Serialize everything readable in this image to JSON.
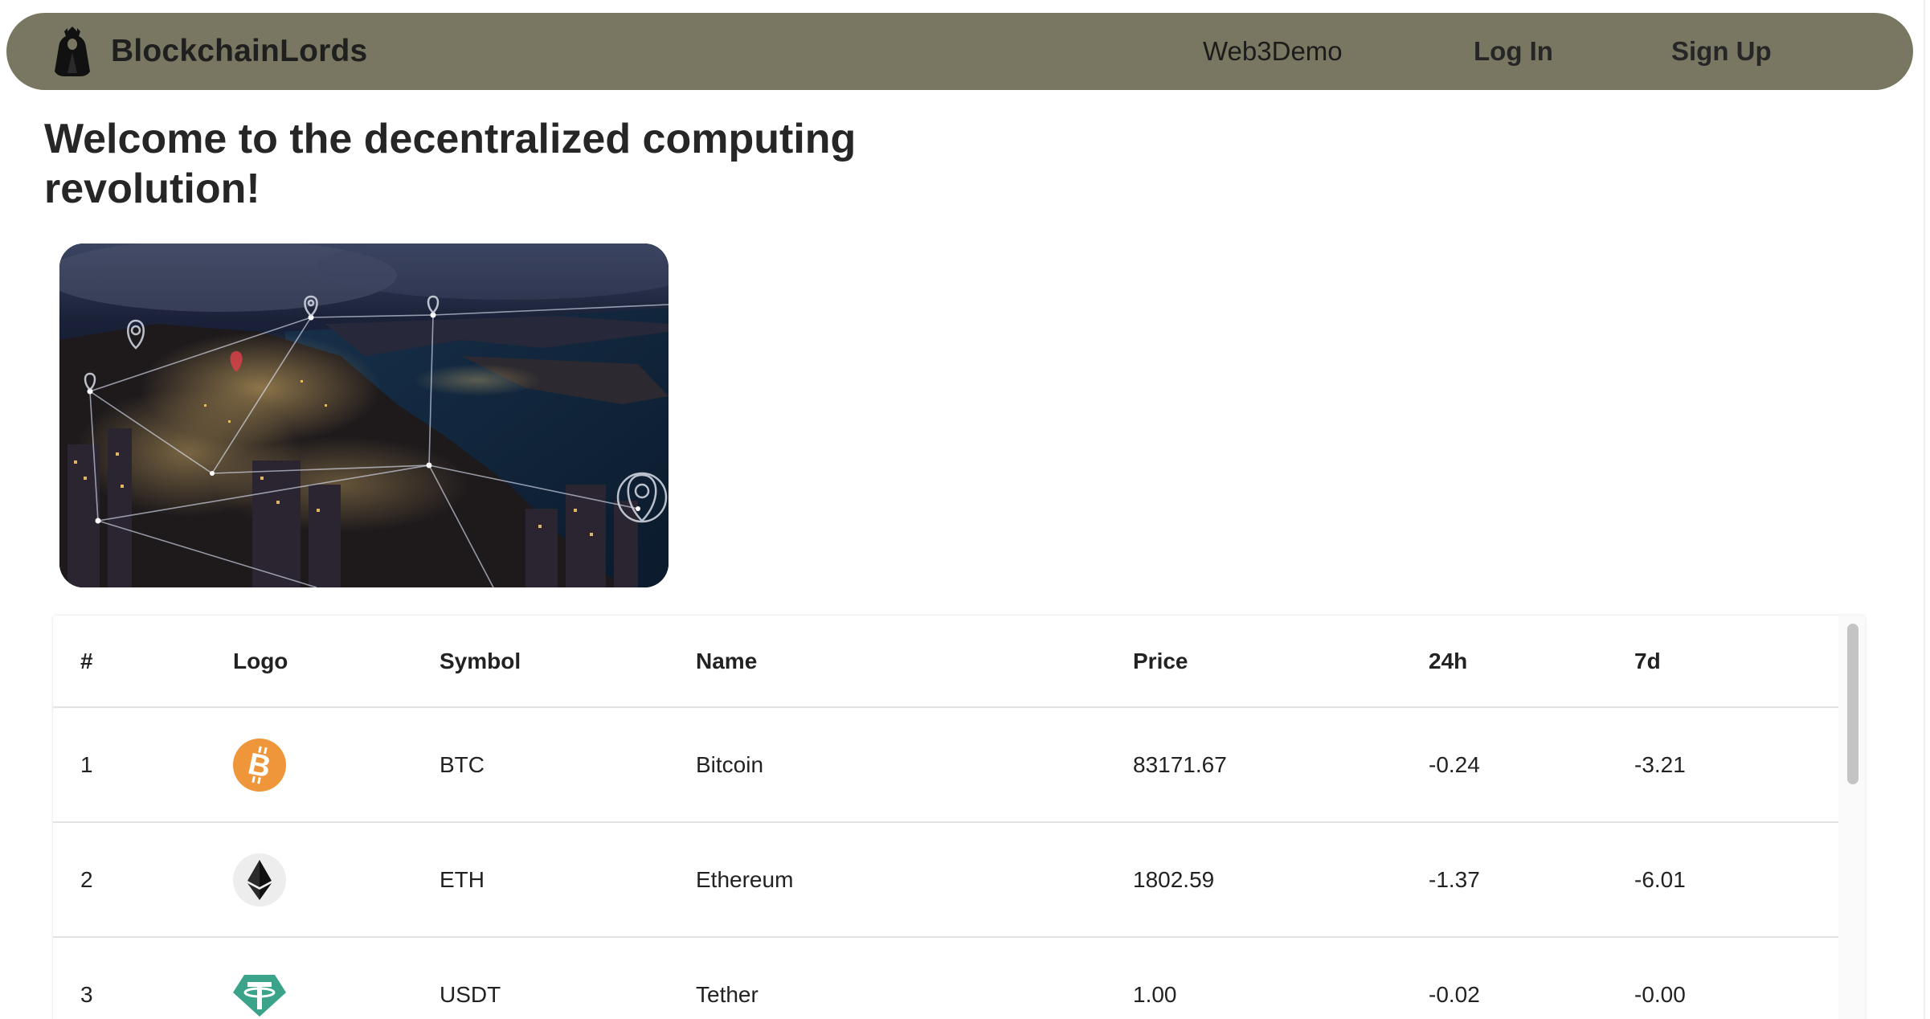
{
  "navbar": {
    "brand_name": "BlockchainLords",
    "brand_logo_icon": "hooded-figure-icon",
    "links": {
      "web3demo": "Web3Demo",
      "login": "Log In",
      "signup": "Sign Up"
    },
    "background_color": "#797761"
  },
  "hero": {
    "title": "Welcome to the decentralized computing revolution!",
    "image_icon": "night-city-network-image"
  },
  "table": {
    "headers": {
      "rank": "#",
      "logo": "Logo",
      "symbol": "Symbol",
      "name": "Name",
      "price": "Price",
      "change_24h": "24h",
      "change_7d": "7d"
    },
    "rows": [
      {
        "rank": "1",
        "logo": "bitcoin-icon",
        "logo_color": "#F0963A",
        "symbol": "BTC",
        "name": "Bitcoin",
        "price": "83171.67",
        "change_24h": "-0.24",
        "change_7d": "-3.21"
      },
      {
        "rank": "2",
        "logo": "ethereum-icon",
        "logo_color": "#EDEDED",
        "symbol": "ETH",
        "name": "Ethereum",
        "price": "1802.59",
        "change_24h": "-1.37",
        "change_7d": "-6.01"
      },
      {
        "rank": "3",
        "logo": "tether-icon",
        "logo_color": "#3AA38A",
        "symbol": "USDT",
        "name": "Tether",
        "price": "1.00",
        "change_24h": "-0.02",
        "change_7d": "-0.00"
      }
    ]
  }
}
